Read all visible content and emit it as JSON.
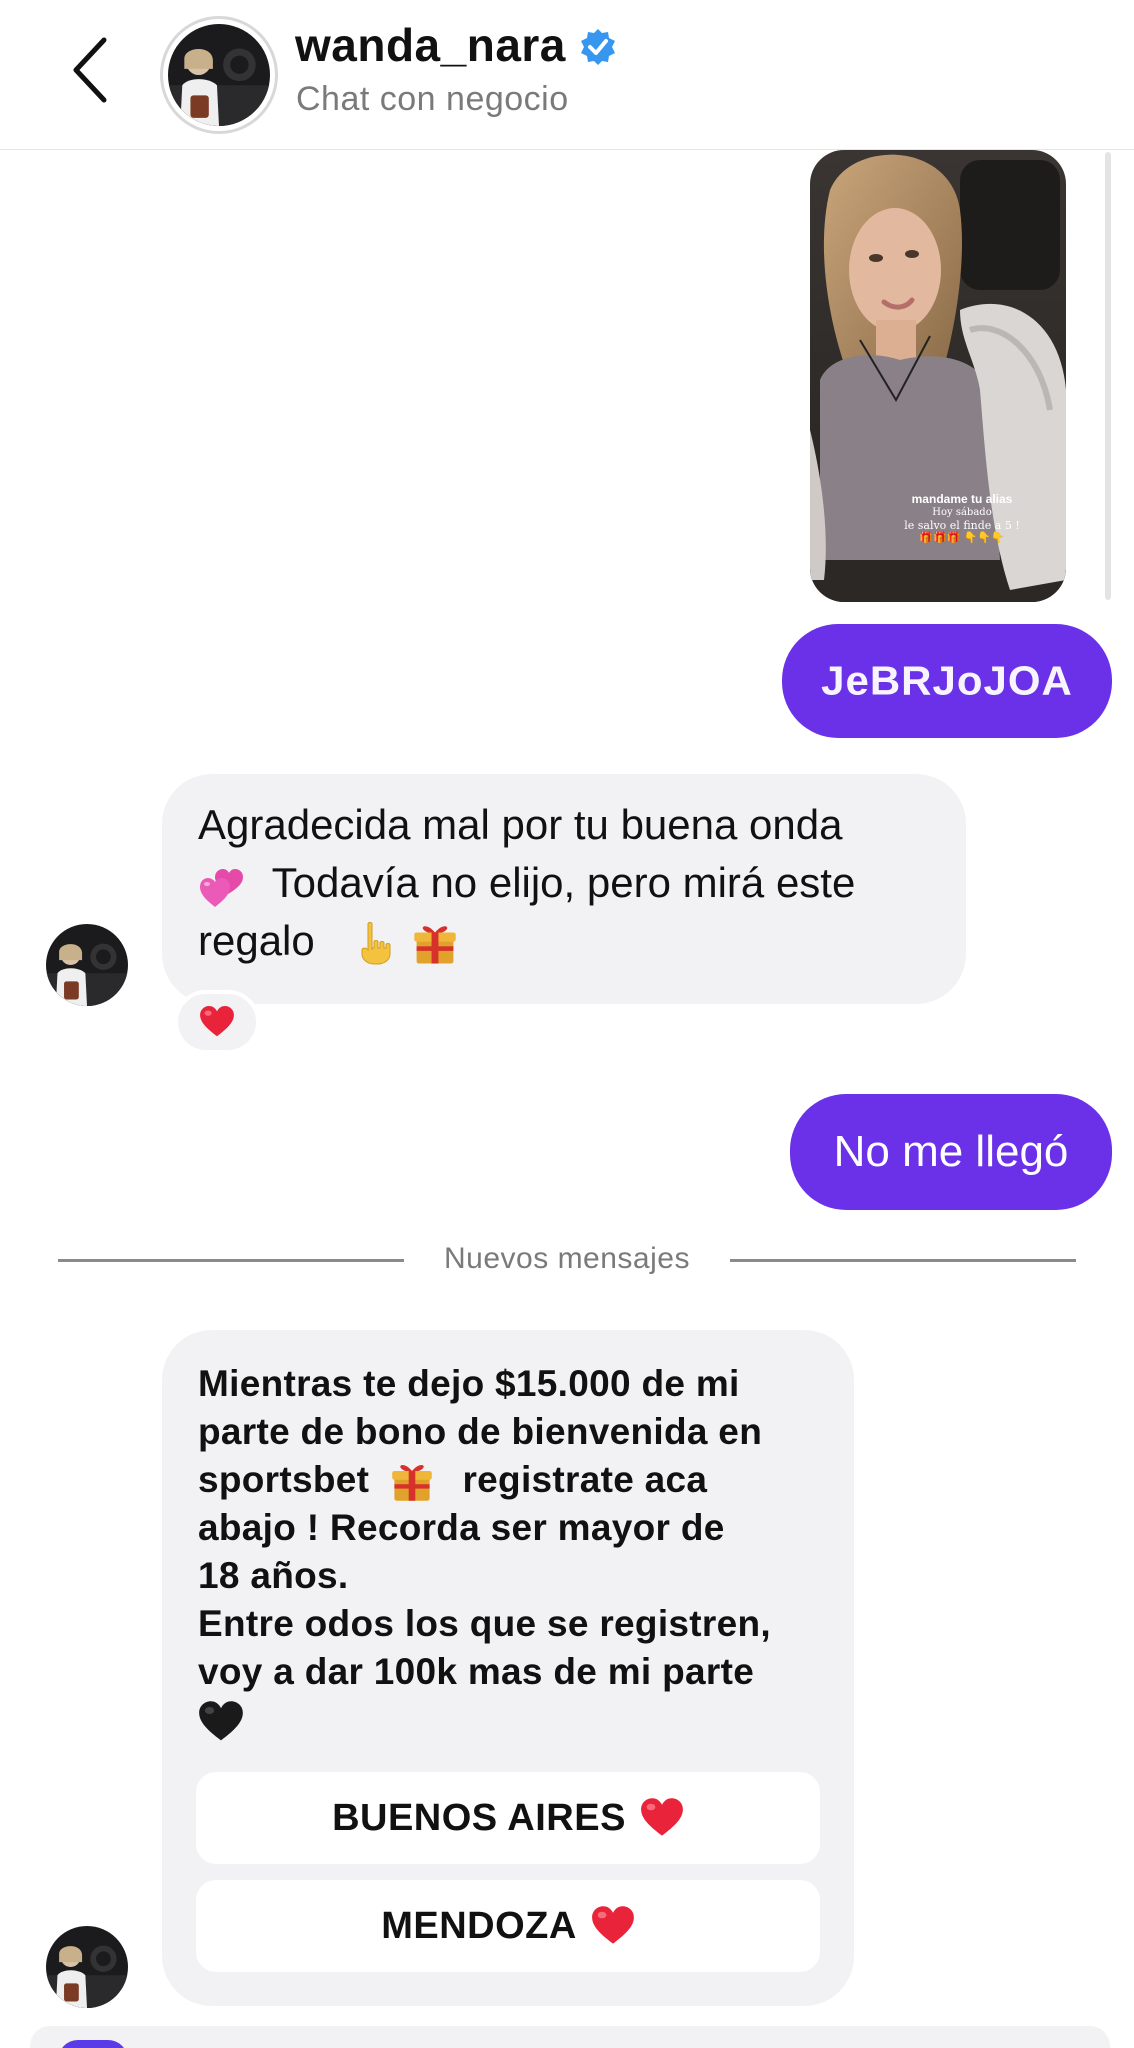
{
  "header": {
    "username": "wanda_nara",
    "subtitle": "Chat con negocio",
    "verified": true
  },
  "story": {
    "line1": "mandame tu alias",
    "line2": "Hoy sábado",
    "line3": "le salvo el finde a 5 !",
    "line4": "🎁🎁🎁 👇👇👇"
  },
  "messages": {
    "outgoing1": "JeBRJoJOA",
    "incoming1": {
      "line1": "Agradecida mal por tu buena onda",
      "line2": "Todavía no elijo, pero mirá este",
      "line3": "regalo"
    },
    "outgoing2": "No me llegó",
    "divider": "Nuevos mensajes",
    "incoming2": {
      "l1": "Mientras te dejo $15.000 de mi",
      "l2": "parte de bono de bienvenida en",
      "l3a": "sportsbet",
      "l3b": "registrate aca",
      "l4": "abajo !  Recorda ser mayor de",
      "l5": "18 años.",
      "l6": "Entre odos los que se registren,",
      "l7": "voy a dar 100k mas de mi parte"
    },
    "quick_replies": [
      "BUENOS AIRES",
      "MENDOZA"
    ]
  },
  "colors": {
    "outgoing_bubble": "#6a31e9",
    "incoming_bubble": "#f2f2f4",
    "verified_badge": "#3797f0",
    "heart": "#e8233a"
  },
  "icons": [
    "chevron-left-icon",
    "verified-badge-icon",
    "two-hearts-icon",
    "pointing-down-icon",
    "gift-icon",
    "heart-icon",
    "black-heart-icon"
  ]
}
